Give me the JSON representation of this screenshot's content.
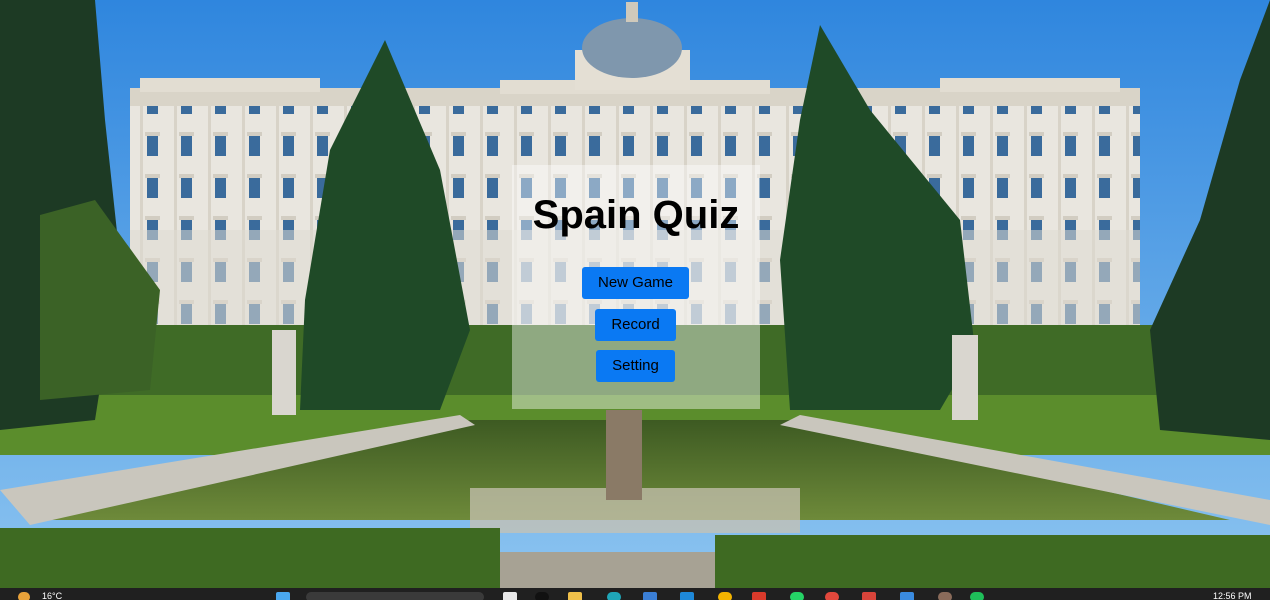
{
  "app": {
    "title": "Spain Quiz"
  },
  "menu": {
    "new_game_label": "New Game",
    "record_label": "Record",
    "setting_label": "Setting"
  },
  "taskbar": {
    "weather_temp": "16°C",
    "clock_time": "12:56 PM",
    "pinned_icons": [
      "windows-start-icon",
      "search-box",
      "file-icon",
      "app-icon",
      "folder-icon",
      "browser-icon",
      "store-icon",
      "app-icon",
      "chrome-icon",
      "mail-icon",
      "whatsapp-icon",
      "app-icon",
      "app-icon",
      "app-icon",
      "user-avatar",
      "app-icon"
    ]
  },
  "colors": {
    "button_bg": "#0a79f3",
    "taskbar_bg": "#202020",
    "sky": "#3f8fde"
  }
}
